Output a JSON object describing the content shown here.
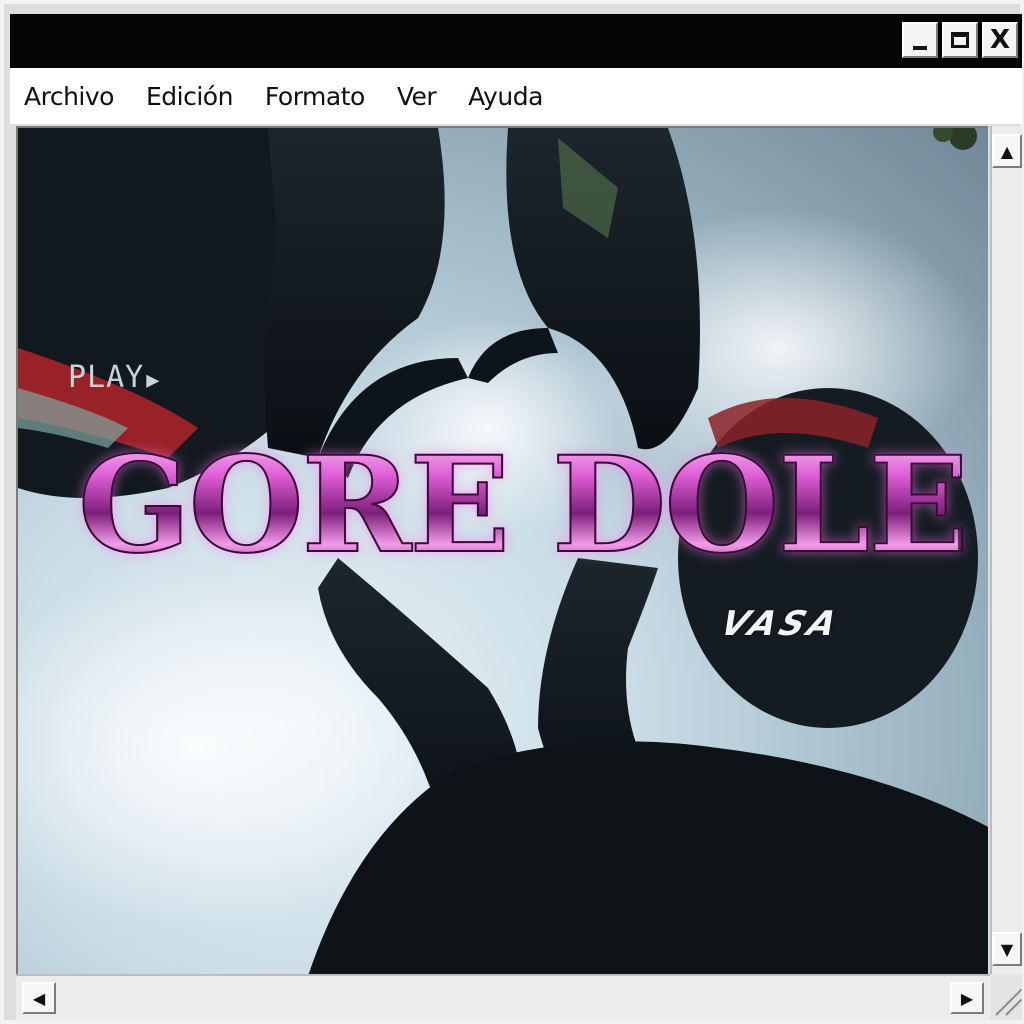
{
  "menu": {
    "items": [
      "Archivo",
      "Edición",
      "Formato",
      "Ver",
      "Ayuda"
    ]
  },
  "window_controls": {
    "minimize_icon": "minimize-icon",
    "maximize_icon": "maximize-icon",
    "close_glyph": "X"
  },
  "artwork": {
    "overlay_label": "PLAY",
    "title": "GORE DOLE",
    "artist": "VASA",
    "title_color": "#d67ad3",
    "overlay_color": "#c9d2d8"
  },
  "scrollbars": {
    "up_icon": "arrow-up-icon",
    "down_icon": "arrow-down-icon",
    "left_icon": "arrow-left-icon",
    "right_icon": "arrow-right-icon"
  },
  "colors": {
    "titlebar": "#050505",
    "menubar": "#ffffff",
    "frame": "#dedede",
    "sky": "#c8dbe5"
  }
}
